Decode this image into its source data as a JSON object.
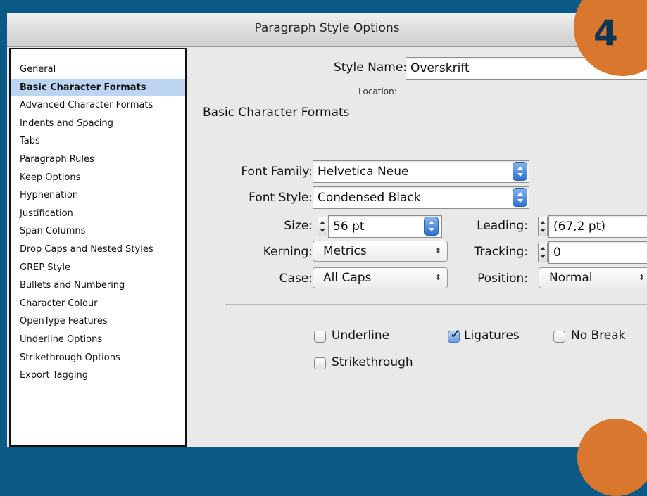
{
  "window": {
    "title": "Paragraph Style Options"
  },
  "step_badge": "4",
  "sidebar": {
    "items": [
      {
        "label": "General",
        "selected": false
      },
      {
        "label": "Basic Character Formats",
        "selected": true
      },
      {
        "label": "Advanced Character Formats",
        "selected": false
      },
      {
        "label": "Indents and Spacing",
        "selected": false
      },
      {
        "label": "Tabs",
        "selected": false
      },
      {
        "label": "Paragraph Rules",
        "selected": false
      },
      {
        "label": "Keep Options",
        "selected": false
      },
      {
        "label": "Hyphenation",
        "selected": false
      },
      {
        "label": "Justification",
        "selected": false
      },
      {
        "label": "Span Columns",
        "selected": false
      },
      {
        "label": "Drop Caps and Nested Styles",
        "selected": false
      },
      {
        "label": "GREP Style",
        "selected": false
      },
      {
        "label": "Bullets and Numbering",
        "selected": false
      },
      {
        "label": "Character Colour",
        "selected": false
      },
      {
        "label": "OpenType Features",
        "selected": false
      },
      {
        "label": "Underline Options",
        "selected": false
      },
      {
        "label": "Strikethrough Options",
        "selected": false
      },
      {
        "label": "Export Tagging",
        "selected": false
      }
    ]
  },
  "main": {
    "style_name_label": "Style Name:",
    "style_name_value": "Overskrift",
    "location_label": "Location:",
    "section_title": "Basic Character Formats",
    "font_family": {
      "label": "Font Family:",
      "value": "Helvetica Neue"
    },
    "font_style": {
      "label": "Font Style:",
      "value": "Condensed Black"
    },
    "size": {
      "label": "Size:",
      "value": "56 pt"
    },
    "leading": {
      "label": "Leading:",
      "value": "(67,2 pt)"
    },
    "kerning": {
      "label": "Kerning:",
      "value": "Metrics"
    },
    "tracking": {
      "label": "Tracking:",
      "value": "0"
    },
    "case": {
      "label": "Case:",
      "value": "All Caps"
    },
    "position": {
      "label": "Position:",
      "value": "Normal"
    },
    "checkboxes": {
      "underline": {
        "label": "Underline",
        "checked": false
      },
      "ligatures": {
        "label": "Ligatures",
        "checked": true
      },
      "no_break": {
        "label": "No Break",
        "checked": false
      },
      "strikethrough": {
        "label": "Strikethrough",
        "checked": false
      }
    }
  },
  "colors": {
    "background": "#0b5a86",
    "badge": "#d9772f",
    "selection": "#bcd5f2"
  }
}
